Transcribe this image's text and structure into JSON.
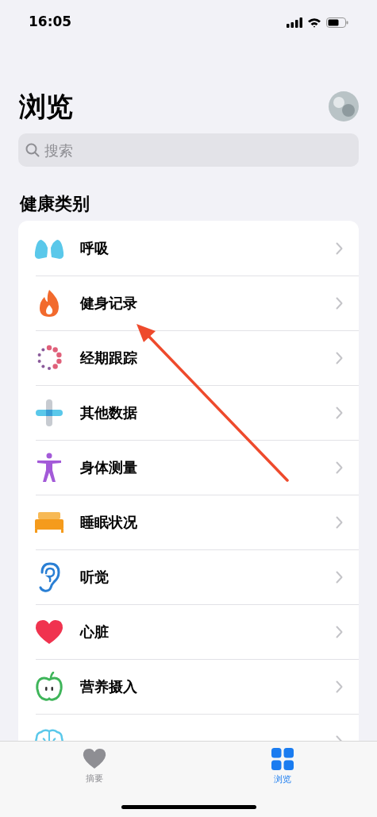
{
  "status_bar": {
    "time": "16:05"
  },
  "title": "浏览",
  "search": {
    "placeholder": "搜索"
  },
  "section_title": "健康类别",
  "categories": [
    {
      "label": "呼吸"
    },
    {
      "label": "健身记录"
    },
    {
      "label": "经期跟踪"
    },
    {
      "label": "其他数据"
    },
    {
      "label": "身体测量"
    },
    {
      "label": "睡眠状况"
    },
    {
      "label": "听觉"
    },
    {
      "label": "心脏"
    },
    {
      "label": "营养摄入"
    }
  ],
  "more_below": true,
  "tabs": [
    {
      "label": "摘要",
      "selected": false
    },
    {
      "label": "浏览",
      "selected": true
    }
  ]
}
